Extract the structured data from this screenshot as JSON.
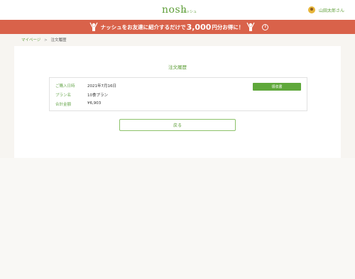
{
  "header": {
    "logo": "nosh",
    "logo_sub": "ナッシュ",
    "user_name": "山田太郎さん"
  },
  "banner": {
    "text_before": "ナッシュをお友達に紹介するだけで",
    "amount": "3,000",
    "text_after": "円分お得に！",
    "info_icon": "info-icon"
  },
  "breadcrumb": {
    "home": "マイページ",
    "separator": ">",
    "current": "注文履歴"
  },
  "page": {
    "title": "注文履歴",
    "order": {
      "date_label": "ご購入日時",
      "date_value": "2021年7月16日",
      "plan_label": "プラン名",
      "plan_value": "10食プラン",
      "total_label": "合計金額",
      "total_value": "¥6,903",
      "receipt_button": "領収書"
    },
    "back_button": "戻る"
  },
  "colors": {
    "accent": "#5f9f3a",
    "banner": "#d9624a"
  }
}
